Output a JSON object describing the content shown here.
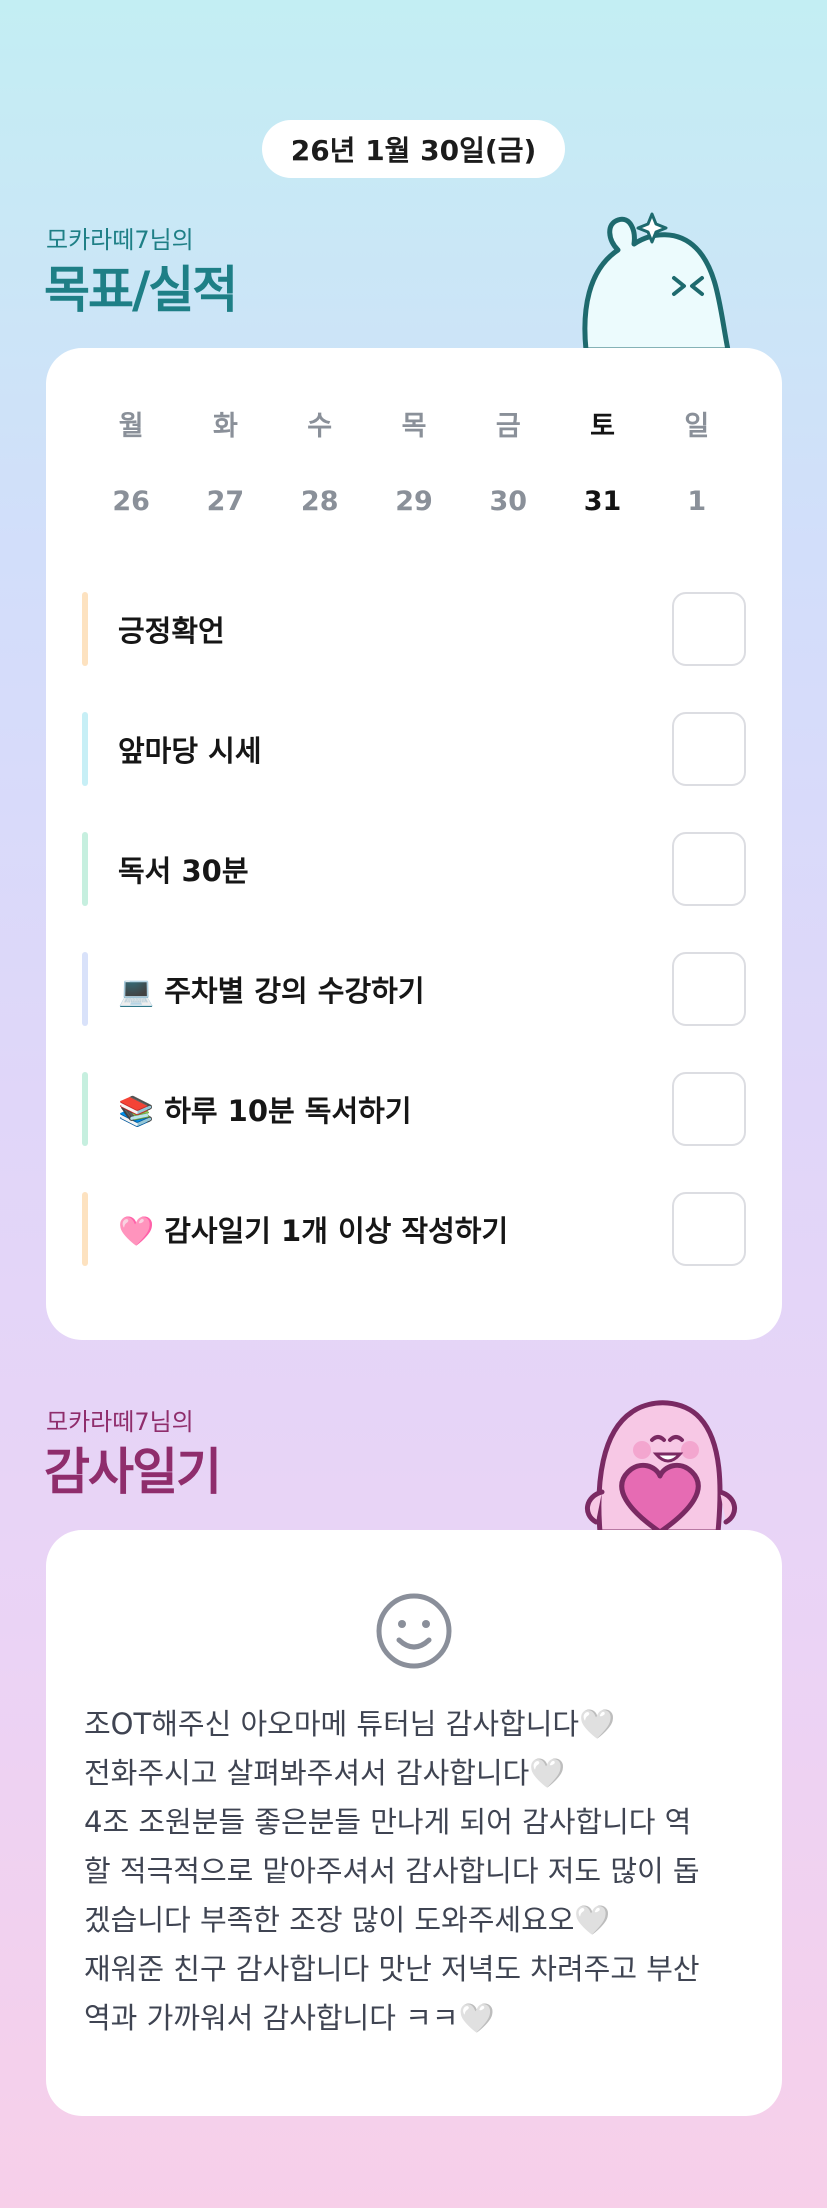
{
  "header": {
    "date": "26년 1월 30일(금)"
  },
  "goals_section": {
    "subtitle": "모카라떼7님의",
    "title": "목표/실적",
    "weekdays": [
      "월",
      "화",
      "수",
      "목",
      "금",
      "토",
      "일"
    ],
    "dates": [
      "26",
      "27",
      "28",
      "29",
      "30",
      "31",
      "1"
    ],
    "active_index": 5,
    "items": [
      {
        "label": "긍정확언",
        "color": "#fde2c0",
        "checked": false
      },
      {
        "label": "앞마당 시세",
        "color": "#c7eff6",
        "checked": false
      },
      {
        "label": "독서 30분",
        "color": "#c6efdf",
        "checked": false
      },
      {
        "label": "💻 주차별 강의 수강하기",
        "color": "#d9e2fa",
        "checked": false
      },
      {
        "label": "📚 하루 10분 독서하기",
        "color": "#c6efdf",
        "checked": false
      },
      {
        "label": "🩷 감사일기 1개 이상 작성하기",
        "color": "#fde2c0",
        "checked": false
      }
    ]
  },
  "diary_section": {
    "subtitle": "모카라떼7님의",
    "title": "감사일기",
    "mood_icon": "smile-face-icon",
    "lines": [
      "조OT해주신 아오마메 튜터님 감사합니다🤍",
      "전화주시고 살펴봐주셔서 감사합니다🤍",
      "4조 조원분들 좋은분들 만나게 되어 감사합니다 역",
      "할 적극적으로 맡아주셔서 감사합니다 저도 많이 돕",
      "겠습니다 부족한 조장 많이 도와주세요오🤍",
      "재워준 친구 감사합니다 맛난 저녁도 차려주고 부산",
      "역과 가까워서 감사합니다 ㅋㅋ🤍"
    ]
  },
  "colors": {
    "teal_title": "#1e7f86",
    "plum_title": "#8f2d6c",
    "active_day": "#141414",
    "inactive_day": "#8a9099"
  }
}
